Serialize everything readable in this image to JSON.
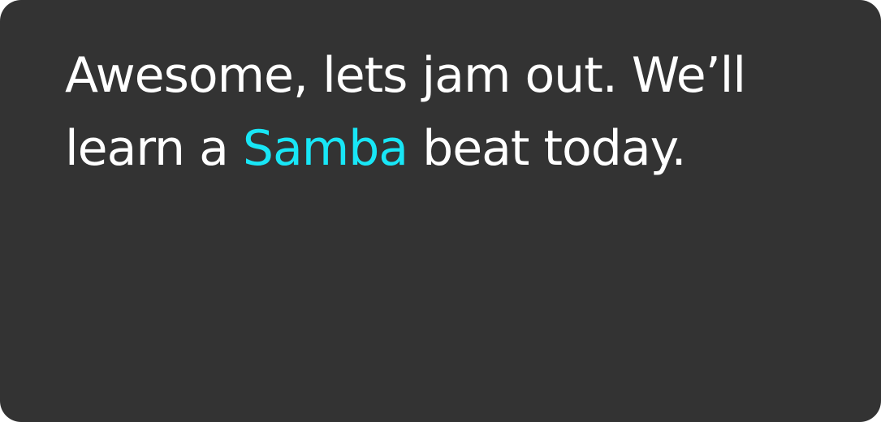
{
  "message": {
    "before": "Awesome, lets jam out. We’ll learn a ",
    "highlight": "Samba",
    "after": " beat today."
  },
  "colors": {
    "card_background": "#333333",
    "text": "#ffffff",
    "highlight": "#18e6f6"
  }
}
